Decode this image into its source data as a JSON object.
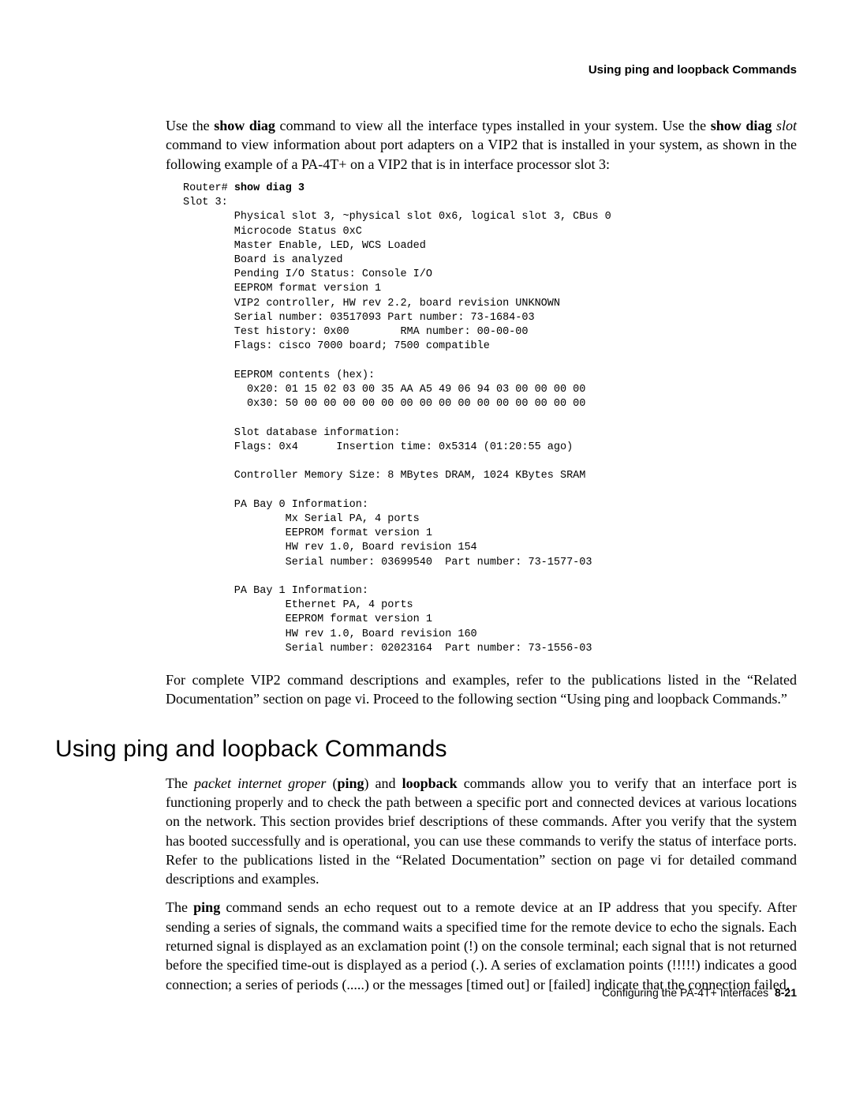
{
  "header": {
    "title": "Using ping and loopback Commands"
  },
  "para1": {
    "t1": "Use the ",
    "b1": "show diag",
    "t2": " command to view all the interface types installed in your system. Use the ",
    "b2": "show diag",
    "t3": " ",
    "i1": "slot",
    "t4": " command to view information about port adapters on a VIP2 that is installed in your system, as shown in the following example of a PA-4T+ on a VIP2 that is in interface processor slot 3:"
  },
  "code": {
    "prompt": "Router# ",
    "cmd": "show diag 3",
    "body": "Slot 3:\n        Physical slot 3, ~physical slot 0x6, logical slot 3, CBus 0\n        Microcode Status 0xC\n        Master Enable, LED, WCS Loaded\n        Board is analyzed \n        Pending I/O Status: Console I/O\n        EEPROM format version 1\n        VIP2 controller, HW rev 2.2, board revision UNKNOWN\n        Serial number: 03517093 Part number: 73-1684-03\n        Test history: 0x00        RMA number: 00-00-00\n        Flags: cisco 7000 board; 7500 compatible\n\n        EEPROM contents (hex):\n          0x20: 01 15 02 03 00 35 AA A5 49 06 94 03 00 00 00 00\n          0x30: 50 00 00 00 00 00 00 00 00 00 00 00 00 00 00 00\n\n        Slot database information:\n        Flags: 0x4      Insertion time: 0x5314 (01:20:55 ago)\n\n        Controller Memory Size: 8 MBytes DRAM, 1024 KBytes SRAM\n\n        PA Bay 0 Information:\n                Mx Serial PA, 4 ports\n                EEPROM format version 1\n                HW rev 1.0, Board revision 154\n                Serial number: 03699540  Part number: 73-1577-03 \n\n        PA Bay 1 Information:\n                Ethernet PA, 4 ports\n                EEPROM format version 1\n                HW rev 1.0, Board revision 160\n                Serial number: 02023164  Part number: 73-1556-03"
  },
  "para2": "For complete VIP2 command descriptions and examples, refer to the publications listed in the “Related Documentation” section on page vi. Proceed to the following section “Using ping and loopback Commands.”",
  "section": {
    "heading": "Using ping and loopback Commands"
  },
  "para3": {
    "t1": "The ",
    "i1": "packet internet groper",
    "t2": " (",
    "b1": "ping",
    "t3": ") and ",
    "b2": "loopback",
    "t4": " commands allow you to verify that an interface port is functioning properly and to check the path between a specific port and connected devices at various locations on the network. This section provides brief descriptions of these commands. After you verify that the system has booted successfully and is operational, you can use these commands to verify the status of interface ports. Refer to the publications listed in the “Related Documentation” section on page vi for detailed command descriptions and examples."
  },
  "para4": {
    "t1": "The ",
    "b1": "ping",
    "t2": " command sends an echo request out to a remote device at an IP address that you specify. After sending a series of signals, the command waits a specified time for the remote device to echo the signals. Each returned signal is displayed as an exclamation point (!) on the console terminal; each signal that is not returned before the specified time-out is displayed as a period (.). A series of exclamation points (!!!!!) indicates a good connection; a series of periods (.....) or the messages [timed out] or [failed] indicate that the connection failed."
  },
  "footer": {
    "text": "Configuring the PA-4T+ Interfaces",
    "pagenum": "8-21"
  }
}
